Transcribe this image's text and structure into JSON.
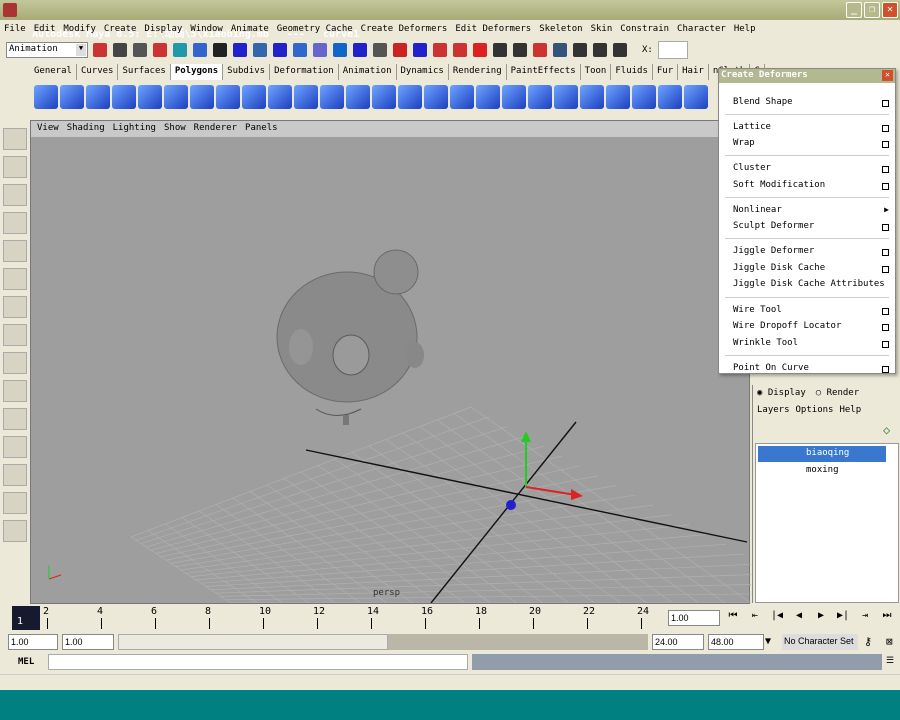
{
  "window": {
    "title": "Autodesk Maya 8.5: E:\\动画\\5\\xiaobing.mb   ---   curve1"
  },
  "menu": [
    "File",
    "Edit",
    "Modify",
    "Create",
    "Display",
    "Window",
    "Animate",
    "Geometry Cache",
    "Create Deformers",
    "Edit Deformers",
    "Skeleton",
    "Skin",
    "Constrain",
    "Character",
    "Help"
  ],
  "toolbar": {
    "mode": "Animation",
    "x_label": "X:"
  },
  "shelf_tabs": [
    "General",
    "Curves",
    "Surfaces",
    "Polygons",
    "Subdivs",
    "Deformation",
    "Animation",
    "Dynamics",
    "Rendering",
    "PaintEffects",
    "Toon",
    "Fluids",
    "Fur",
    "Hair",
    "nCloth",
    "C"
  ],
  "active_shelf": "Polygons",
  "viewport": {
    "menu": [
      "View",
      "Shading",
      "Lighting",
      "Show",
      "Renderer",
      "Panels"
    ],
    "camera": "persp"
  },
  "deformers_menu": {
    "title": "Create Deformers",
    "items": [
      "Blend Shape",
      "Lattice",
      "Wrap",
      "Cluster",
      "Soft Modification",
      "Nonlinear",
      "Sculpt Deformer",
      "Jiggle Deformer",
      "Jiggle Disk Cache",
      "Jiggle Disk Cache Attributes",
      "Wire Tool",
      "Wire Dropoff Locator",
      "Wrinkle Tool",
      "Point On Curve"
    ]
  },
  "layers": {
    "display": "Display",
    "render": "Render",
    "menu": [
      "Layers",
      "Options",
      "Help"
    ],
    "items": [
      "biaoqing",
      "moxing"
    ],
    "selected": "biaoqing"
  },
  "timeline": {
    "ticks": [
      "2",
      "4",
      "6",
      "8",
      "10",
      "12",
      "14",
      "16",
      "18",
      "20",
      "22",
      "24"
    ],
    "current": "1",
    "current_field": "1.00"
  },
  "range": {
    "start": "1.00",
    "start2": "1.00",
    "end": "24.00",
    "end2": "48.00",
    "character": "No Character Set"
  },
  "cmdline": {
    "label": "MEL"
  },
  "colors": {
    "title": "#a7ab78",
    "layer_selected": "#3a78d0",
    "taskbar": "#008080",
    "viewport": "#9e9e9e"
  }
}
